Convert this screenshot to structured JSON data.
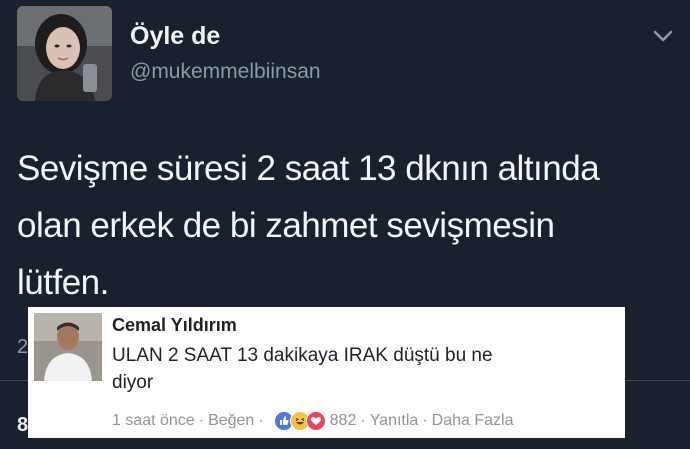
{
  "tweet": {
    "display_name": "Öyle de",
    "username": "@mukemmelbiinsan",
    "text_lines": [
      "Sevişme süresi 2 saat 13 dknın altında",
      "olan erkek de bi zahmet sevişmesin",
      "lütfen."
    ],
    "partial_count_top": "2",
    "partial_count_bottom": "8"
  },
  "comment": {
    "author": "Cemal Yıldırım",
    "text_lines": [
      "ULAN 2 SAAT 13 dakikaya IRAK düştü bu ne",
      "diyor"
    ],
    "time": "1 saat önce",
    "like_action": "Beğen",
    "reaction_count": "882",
    "reply_action": "Yanıtla",
    "more_action": "Daha Fazla",
    "separator": "·",
    "reactions": [
      "like-icon",
      "haha-icon",
      "love-icon"
    ]
  },
  "colors": {
    "background": "#19212e",
    "username": "#8b98a8",
    "comment_bg": "#ffffff",
    "like_blue": "#4a78e0",
    "haha_yellow": "#f5c33b",
    "love_red": "#f0415a"
  }
}
